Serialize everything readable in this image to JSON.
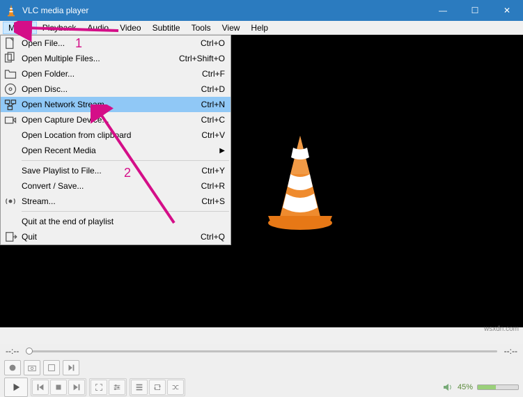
{
  "window": {
    "title": "VLC media player",
    "minimize": "—",
    "maximize": "☐",
    "close": "✕"
  },
  "menubar": {
    "items": [
      "Media",
      "Playback",
      "Audio",
      "Video",
      "Subtitle",
      "Tools",
      "View",
      "Help"
    ],
    "active_index": 0
  },
  "dropdown": [
    {
      "type": "item",
      "icon": "file",
      "label": "Open File...",
      "shortcut": "Ctrl+O"
    },
    {
      "type": "item",
      "icon": "files",
      "label": "Open Multiple Files...",
      "shortcut": "Ctrl+Shift+O"
    },
    {
      "type": "item",
      "icon": "folder",
      "label": "Open Folder...",
      "shortcut": "Ctrl+F"
    },
    {
      "type": "item",
      "icon": "disc",
      "label": "Open Disc...",
      "shortcut": "Ctrl+D"
    },
    {
      "type": "item",
      "icon": "network",
      "label": "Open Network Stream...",
      "shortcut": "Ctrl+N",
      "highlight": true
    },
    {
      "type": "item",
      "icon": "capture",
      "label": "Open Capture Device...",
      "shortcut": "Ctrl+C"
    },
    {
      "type": "item",
      "icon": "",
      "label": "Open Location from clipboard",
      "shortcut": "Ctrl+V"
    },
    {
      "type": "item",
      "icon": "",
      "label": "Open Recent Media",
      "shortcut": "",
      "submenu": true
    },
    {
      "type": "sep"
    },
    {
      "type": "item",
      "icon": "",
      "label": "Save Playlist to File...",
      "shortcut": "Ctrl+Y"
    },
    {
      "type": "item",
      "icon": "",
      "label": "Convert / Save...",
      "shortcut": "Ctrl+R"
    },
    {
      "type": "item",
      "icon": "stream",
      "label": "Stream...",
      "shortcut": "Ctrl+S"
    },
    {
      "type": "sep"
    },
    {
      "type": "item",
      "icon": "",
      "label": "Quit at the end of playlist",
      "shortcut": ""
    },
    {
      "type": "item",
      "icon": "quit",
      "label": "Quit",
      "shortcut": "Ctrl+Q"
    }
  ],
  "annotations": {
    "label1": "1",
    "label2": "2"
  },
  "time": {
    "left": "--:--",
    "right": "--:--"
  },
  "volume": {
    "percent": "45%"
  },
  "watermark": "wsxdn.com"
}
